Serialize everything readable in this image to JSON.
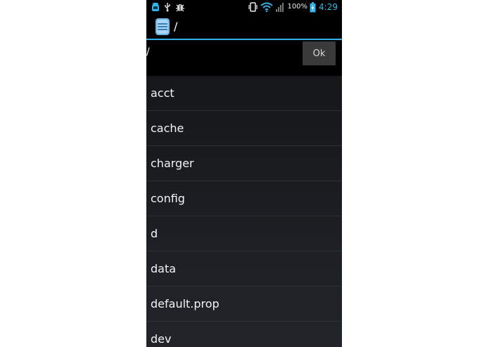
{
  "status_bar": {
    "battery_percent": "100%",
    "time": "4:29",
    "icons": [
      "android-notification-icon",
      "usb-icon",
      "debug-icon",
      "vibrate-icon",
      "wifi-icon",
      "signal-icon",
      "battery-charging-icon"
    ]
  },
  "action_bar": {
    "title": "/",
    "icon": "file-manager-app-icon"
  },
  "path_bar": {
    "value": "/",
    "ok_label": "Ok"
  },
  "files": [
    {
      "name": "acct"
    },
    {
      "name": "cache"
    },
    {
      "name": "charger"
    },
    {
      "name": "config"
    },
    {
      "name": "d"
    },
    {
      "name": "data"
    },
    {
      "name": "default.prop"
    },
    {
      "name": "dev"
    }
  ],
  "colors": {
    "accent": "#35b2e6",
    "background": "#15171a",
    "bar": "#000000",
    "button": "#3a3a3a"
  }
}
